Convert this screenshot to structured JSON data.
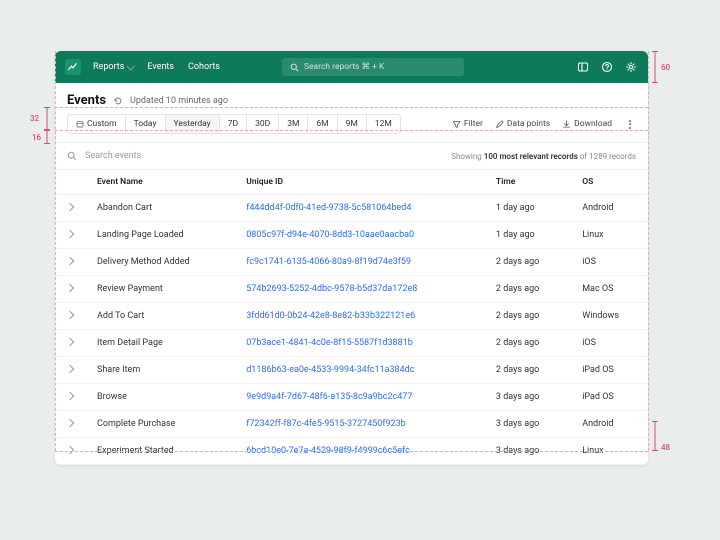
{
  "nav": {
    "reports": "Reports",
    "events": "Events",
    "cohorts": "Cohorts"
  },
  "search": {
    "placeholder": "Search reports ⌘ + K"
  },
  "page": {
    "title": "Events",
    "updated": "Updated 10 minutes ago"
  },
  "ranges": {
    "custom": "Custom",
    "today": "Today",
    "yesterday": "Yesterday",
    "d7": "7D",
    "d30": "30D",
    "m3": "3M",
    "m6": "6M",
    "m9": "9M",
    "m12": "12M"
  },
  "tools": {
    "filter": "Filter",
    "datapoints": "Data points",
    "download": "Download"
  },
  "eventSearch": {
    "placeholder": "Search events"
  },
  "showing": {
    "prefix": "Showing ",
    "bold": "100 most relevant records",
    "suffix": " of 1289 records"
  },
  "columns": {
    "name": "Event Name",
    "uid": "Unique ID",
    "time": "Time",
    "os": "OS"
  },
  "rows": [
    {
      "name": "Abandon Cart",
      "uid": "f444dd4f-0df0-41ed-9738-5c581064bed4",
      "time": "1 day ago",
      "os": "Android"
    },
    {
      "name": "Landing Page Loaded",
      "uid": "0805c97f-d94e-4070-8dd3-10aae0aacba0",
      "time": "1 day ago",
      "os": "Linux"
    },
    {
      "name": "Delivery Method Added",
      "uid": "fc9c1741-6135-4066-80a9-8f19d74e3f59",
      "time": "2 days ago",
      "os": "iOS"
    },
    {
      "name": "Review Payment",
      "uid": "574b2693-5252-4dbc-9578-b5d37da172e8",
      "time": "2 days ago",
      "os": "Mac OS"
    },
    {
      "name": "Add To Cart",
      "uid": "3fdd61d0-0b24-42e8-8e82-b33b322121e6",
      "time": "2 days ago",
      "os": "Windows"
    },
    {
      "name": "Item Detail Page",
      "uid": "07b3ace1-4841-4c0e-8f15-5587f1d3881b",
      "time": "2 days ago",
      "os": "iOS"
    },
    {
      "name": "Share Item",
      "uid": "d1186b63-ea0e-4533-9994-34fc11a384dc",
      "time": "2 days ago",
      "os": "iPad OS"
    },
    {
      "name": "Browse",
      "uid": "9e9d9a4f-7d67-48f6-a135-8c9a9bc2c477",
      "time": "3 days ago",
      "os": "iPad OS"
    },
    {
      "name": "Complete Purchase",
      "uid": "f72342ff-f87c-4fe5-9515-3727450f923b",
      "time": "3 days ago",
      "os": "Android"
    },
    {
      "name": "Experiment Started",
      "uid": "6bcd10e0-7e7a-4529-98f9-f4999c6c5efc",
      "time": "3 days ago",
      "os": "Linux"
    }
  ],
  "anno": {
    "topbarH": "60",
    "toolbarH": "32",
    "gap": "16",
    "bottomGap": "48"
  }
}
